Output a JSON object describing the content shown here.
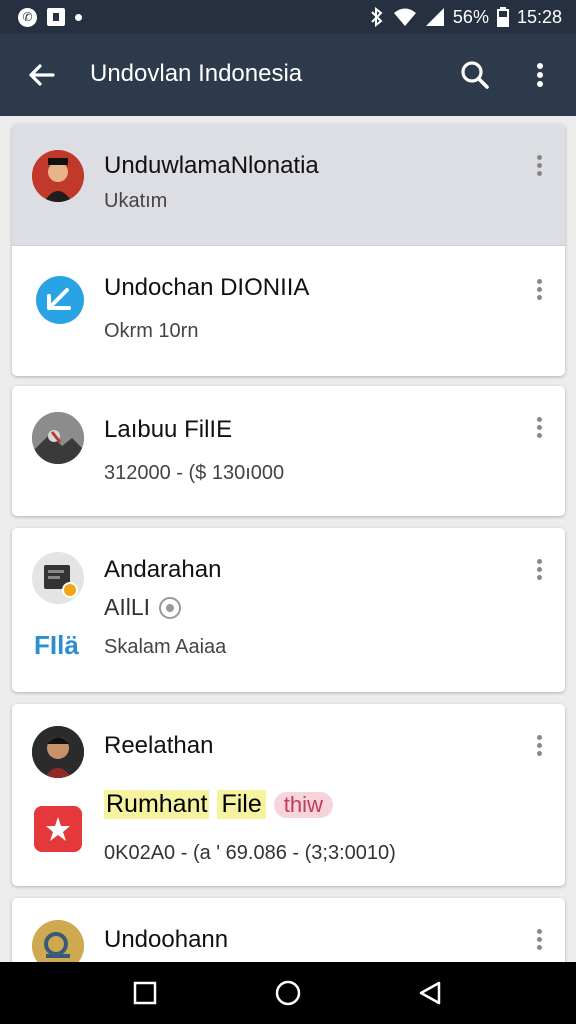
{
  "status_bar": {
    "left_icons": [
      "whatsapp-icon",
      "gallery-icon",
      "notification-dot-icon"
    ],
    "battery": "56%",
    "time": "15:28"
  },
  "app_bar": {
    "title": "Undovlan Indonesia"
  },
  "items": [
    {
      "title": "UnduwlamaNlonatia",
      "subtitle": "Ukatım",
      "avatar": "person-avatar"
    },
    {
      "title": "Undochan DIONIIA",
      "subtitle": "Okrm 10rn",
      "avatar": "download-app-icon"
    },
    {
      "title": "Laıbuu FilIE",
      "subtitle": "312000 - ($ 130ı000",
      "avatar": "landscape-thumbnail"
    },
    {
      "title": "Andarahan",
      "subtitle": "AIlLI",
      "app_label": "FIlä",
      "app_sub": "Skalam Aaiaa",
      "avatar": "app-icon"
    },
    {
      "title": "Reelathan",
      "tag1": "Rumhant",
      "tag2": "File",
      "tag3": "thiw",
      "subtitle": "0K02A0 - (a ' 69.086 - (3;3:0010)",
      "avatar": "person-avatar"
    },
    {
      "title": "Undoohann",
      "avatar": "app-icon"
    }
  ],
  "colors": {
    "status_bar": "#263040",
    "app_bar": "#2d3a4c",
    "highlight_row": "#dddee3",
    "accent_blue": "#29a3e3",
    "tag_yellow": "#f5f2a0",
    "tag_pink": "#f7d3dc",
    "red_app": "#e5383b"
  }
}
